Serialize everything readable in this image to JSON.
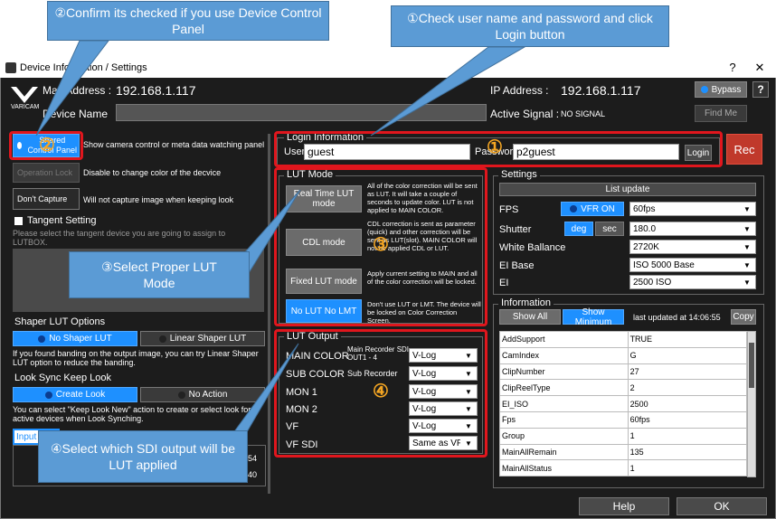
{
  "callouts": {
    "c1": "①Check user name and password and click Login button",
    "c2": "②Confirm its checked  if you use Device Control Panel",
    "c3": "③Select Proper LUT Mode",
    "c4": "④Select which SDI output will be LUT applied"
  },
  "markers": {
    "m1": "①",
    "m2": "②",
    "m3": "③",
    "m4": "④"
  },
  "window": {
    "title": "Device Information / Settings",
    "help_btn": "?",
    "close_btn": "✕"
  },
  "top": {
    "mac_label": "Mac Address :",
    "mac_value": "192.168.1.117",
    "brand": "VARICAM",
    "device_name_label": "Device Name",
    "ip_label": "IP Address :",
    "ip_value": "192.168.1.117",
    "active_signal_label": "Active Signal :",
    "active_signal_value": "NO SIGNAL",
    "bypass": "Bypass",
    "help": "?",
    "find_me": "Find Me"
  },
  "left": {
    "shared_btn": "Shared Control Panel",
    "shared_desc": "Show camera control or meta data watching panel",
    "op_lock_btn": "Operation Lock",
    "op_lock_desc": "Disable to change color of the decvice",
    "dont_capture_btn": "Don't Capture",
    "dont_capture_desc": "Will not capture image when keeping look",
    "tangent_label": "Tangent Setting",
    "tangent_desc": "Please select the tangent device you are going to assign to LUTBOX.",
    "shaper_title": "Shaper LUT Options",
    "no_shaper": "No Shaper LUT",
    "linear_shaper": "Linear Shaper LUT",
    "shaper_desc": "If you found banding on the output image, you can try Linear Shaper LUT option to reduce the banding.",
    "look_sync_title": "Look Sync Keep Look",
    "create_look": "Create Look",
    "no_action": "No Action",
    "look_sync_desc": "You can select \"Keep Look New\" action to create or select look for active devices when Look Synching.",
    "input_tab": "Input",
    "tail1": "54",
    "tail2": "40"
  },
  "login": {
    "title": "Login Information",
    "user_label": "User",
    "user_value": "guest",
    "password_label": "Password",
    "password_value": "p2guest",
    "login_btn": "Login",
    "rec_btn": "Rec"
  },
  "lut_mode": {
    "title": "LUT Mode",
    "modes": [
      {
        "label": "Real Time LUT mode",
        "desc": "All of the color correction will be sent as LUT. It will take a couple of seconds to update color. LUT is not applied to MAIN COLOR."
      },
      {
        "label": "CDL mode",
        "desc": "CDL correction is sent as parameter (quick) and other correction will be sent as LUT(slot). MAIN COLOR will not be applied CDL or LUT."
      },
      {
        "label": "Fixed LUT mode",
        "desc": "Apply current setting to MAIN and all of the color correction will be locked."
      },
      {
        "label": "No LUT No LMT",
        "desc": "Don't use LUT or LMT. The device will be locked on Color Correction Screen."
      }
    ]
  },
  "lut_output": {
    "title": "LUT Output",
    "main_recorder": "Main Recorder SDI OUT1 - 4",
    "sub_recorder": "Sub Recorder",
    "rows": [
      {
        "label": "MAIN COLOR",
        "value": "V-Log"
      },
      {
        "label": "SUB COLOR",
        "value": "V-Log"
      },
      {
        "label": "MON 1",
        "value": "V-Log"
      },
      {
        "label": "MON 2",
        "value": "V-Log"
      },
      {
        "label": "VF",
        "value": "V-Log"
      },
      {
        "label": "VF SDI",
        "value": "Same as VF"
      }
    ]
  },
  "settings": {
    "title": "Settings",
    "list_update": "List update",
    "fps_label": "FPS",
    "vfr": "VFR ON",
    "fps_value": "60fps",
    "shutter_label": "Shutter",
    "deg": "deg",
    "sec": "sec",
    "shutter_value": "180.0",
    "wb_label": "White Ballance",
    "wb_value": "2720K",
    "eibase_label": "EI Base",
    "eibase_value": "ISO 5000 Base",
    "ei_label": "EI",
    "ei_value": "2500 ISO"
  },
  "information": {
    "title": "Information",
    "show_all": "Show All",
    "show_min": "Show Minimum",
    "updated": "last updated at 14:06:55",
    "copy": "Copy",
    "rows": [
      {
        "k": "AddSupport",
        "v": "TRUE"
      },
      {
        "k": "CamIndex",
        "v": "G"
      },
      {
        "k": "ClipNumber",
        "v": "27"
      },
      {
        "k": "ClipReelType",
        "v": "2"
      },
      {
        "k": "EI_ISO",
        "v": "2500"
      },
      {
        "k": "Fps",
        "v": "60fps"
      },
      {
        "k": "Group",
        "v": "1"
      },
      {
        "k": "MainAllRemain",
        "v": "135"
      },
      {
        "k": "MainAllStatus",
        "v": "1"
      }
    ]
  },
  "footer": {
    "help": "Help",
    "ok": "OK"
  }
}
